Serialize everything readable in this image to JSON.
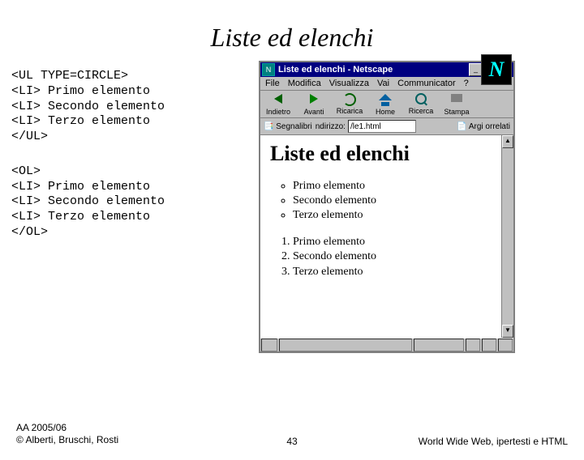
{
  "slide": {
    "title": "Liste ed elenchi",
    "code_ul": "<UL TYPE=CIRCLE>\n<LI> Primo elemento\n<LI> Secondo elemento\n<LI> Terzo elemento\n</UL>",
    "code_ol": "<OL>\n<LI> Primo elemento\n<LI> Secondo elemento\n<LI> Terzo elemento\n</OL>"
  },
  "browser": {
    "window_title": "Liste ed elenchi - Netscape",
    "sysmenu_min": "_",
    "sysmenu_max": "□",
    "sysmenu_close": "×",
    "menubar": {
      "file": "File",
      "edit": "Modifica",
      "view": "Visualizza",
      "go": "Vai",
      "comm": "Communicator",
      "help": "?"
    },
    "toolbar": {
      "back": "Indietro",
      "forward": "Avanti",
      "reload": "Ricarica",
      "home": "Home",
      "search": "Ricerca",
      "print": "Stampa"
    },
    "toolbar2": {
      "bookmarks": "Segnalibri",
      "addr_label": "ndirizzo:",
      "addr_value": "/le1.html",
      "related": "Argi orrelati"
    },
    "netscape_logo": "N"
  },
  "page": {
    "heading": "Liste ed elenchi",
    "ul_items": [
      "Primo elemento",
      "Secondo elemento",
      "Terzo elemento"
    ],
    "ol_items": [
      "Primo elemento",
      "Secondo elemento",
      "Terzo elemento"
    ]
  },
  "footer": {
    "left1": "AA 2005/06",
    "left2": "© Alberti, Bruschi, Rosti",
    "page_num": "43",
    "right": "World Wide Web, ipertesti e HTML"
  }
}
